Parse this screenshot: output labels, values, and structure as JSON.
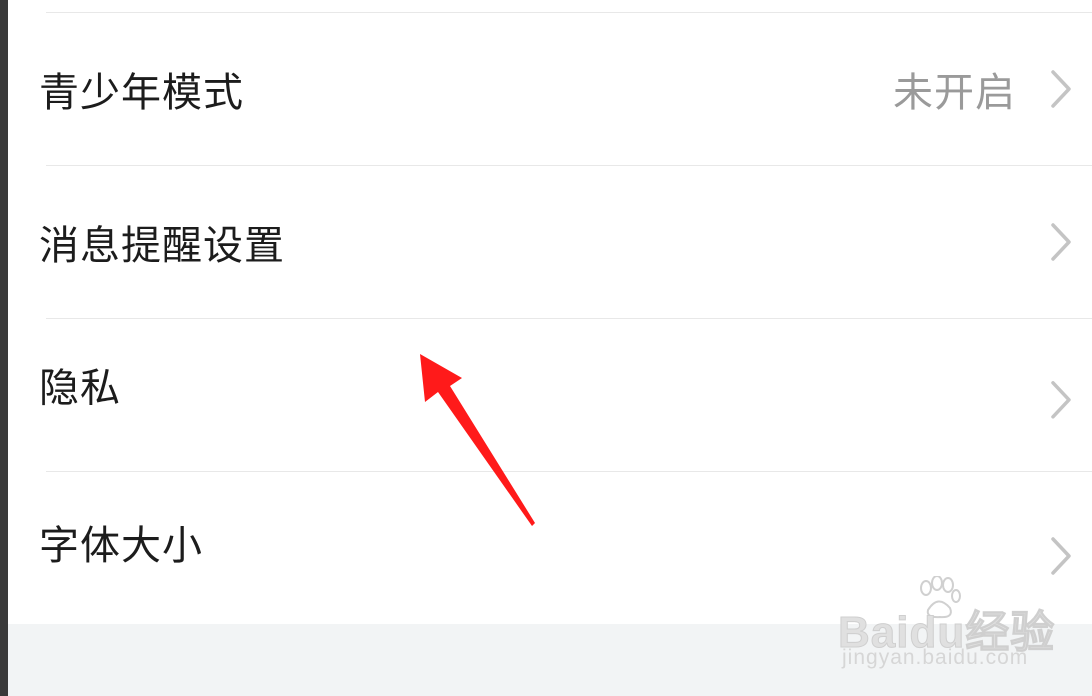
{
  "settings": {
    "items": [
      {
        "label": "青少年模式",
        "value": "未开启"
      },
      {
        "label": "消息提醒设置",
        "value": ""
      },
      {
        "label": "隐私",
        "value": ""
      },
      {
        "label": "字体大小",
        "value": ""
      }
    ]
  },
  "watermark": {
    "brand": "Baidu经验",
    "url": "jingyan.baidu.com"
  },
  "colors": {
    "label": "#1c1c1c",
    "value": "#9a9a9a",
    "chevron": "#c4c4c4",
    "divider": "#e8e8e8",
    "footer_band": "#f2f4f5",
    "annotation_arrow": "#ff1a1a"
  },
  "icons": {
    "chevron": "chevron-right-icon",
    "annotation": "red-arrow-annotation"
  }
}
